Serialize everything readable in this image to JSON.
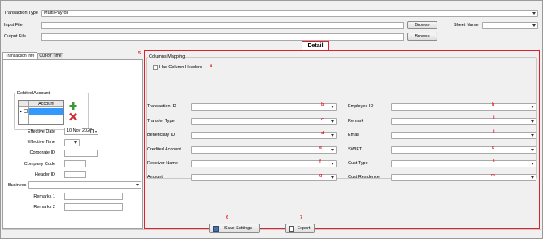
{
  "top": {
    "transaction_type_label": "Transaction Type",
    "transaction_type_value": "Multi Payroll",
    "input_file_label": "Input File",
    "output_file_label": "Output File",
    "browse_label": "Browse",
    "sheet_name_label": "Sheet Name"
  },
  "detail_tab": "Detail",
  "tabs": [
    "Transaction Info",
    "Cut-off Time"
  ],
  "debited": {
    "title": "Debited Account",
    "column": "Account"
  },
  "fields": {
    "effective_date_label": "Effective Date",
    "effective_date_value": "10 Nov 2020",
    "effective_time_label": "Effective Time",
    "corporate_id_label": "Corporate ID",
    "company_code_label": "Company Code",
    "header_id_label": "Header ID",
    "business_type_label": "Business Type",
    "remarks1_label": "Remarks 1",
    "remarks2_label": "Remarks 2"
  },
  "mapping": {
    "title": "Columns Mapping",
    "has_headers_label": "Has Column Headers",
    "left": [
      "Transaction ID",
      "Transfer Type",
      "Beneficiary ID",
      "Credited Account",
      "Receiver Name",
      "Amount"
    ],
    "right": [
      "Employee ID",
      "Remark",
      "Email",
      "SWIFT",
      "Cust Type",
      "Cust Residence"
    ]
  },
  "annotations": {
    "a": "a",
    "left": [
      "b",
      "c",
      "d",
      "e",
      "f",
      "g"
    ],
    "right": [
      "h",
      "i",
      "j",
      "k",
      "l",
      "m"
    ],
    "n5": "5",
    "n6": "6",
    "n7": "7"
  },
  "bottom": {
    "save_label": "Save Settings",
    "export_label": "Export"
  },
  "colors": {
    "annotation_red": "#e0212b",
    "selection_blue": "#3399ff",
    "add_green": "#3a9b32",
    "remove_red": "#d32f2f"
  }
}
